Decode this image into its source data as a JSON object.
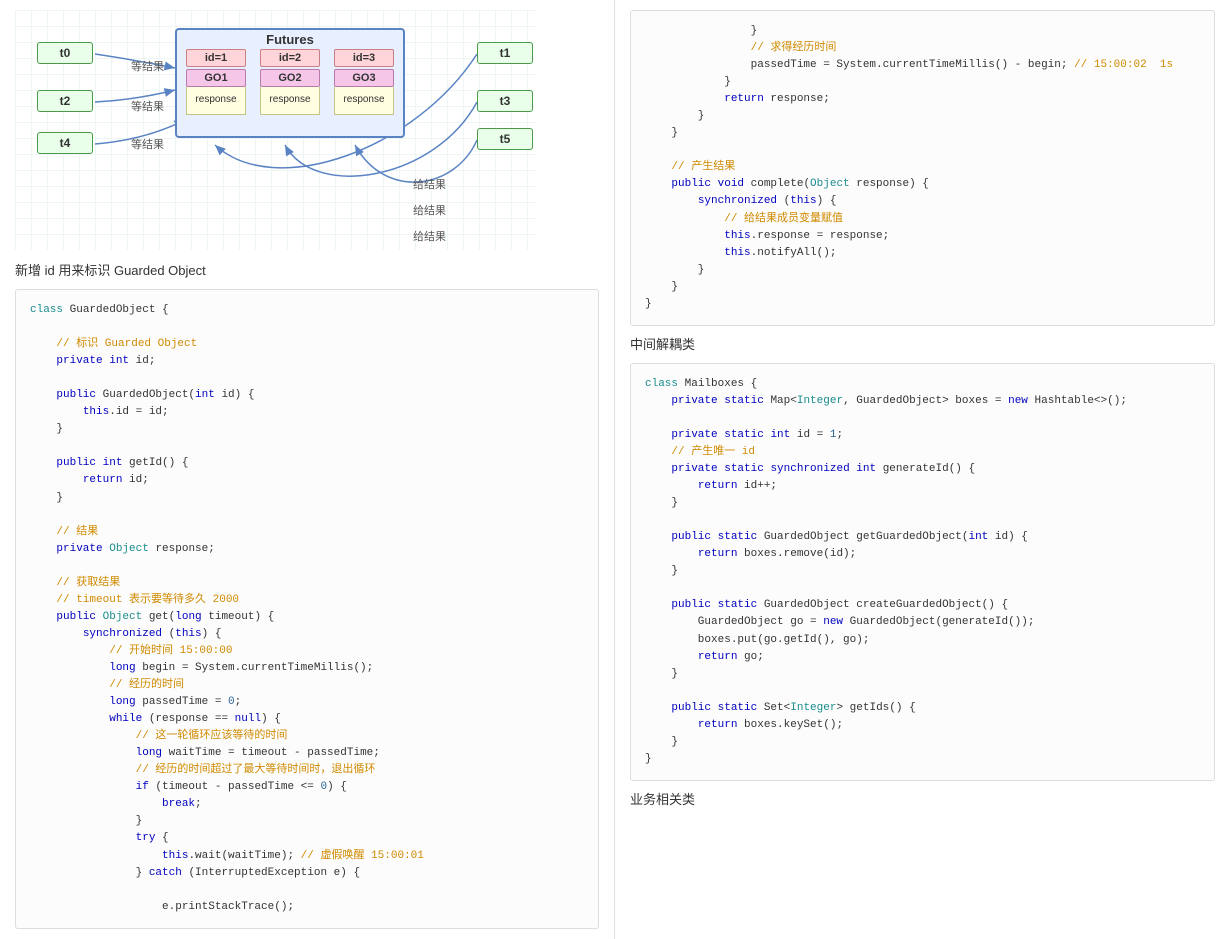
{
  "diagram": {
    "title": "Futures",
    "left_threads": [
      "t0",
      "t2",
      "t4"
    ],
    "right_threads": [
      "t1",
      "t3",
      "t5"
    ],
    "ids": [
      "id=1",
      "id=2",
      "id=3"
    ],
    "gos": [
      "GO1",
      "GO2",
      "GO3"
    ],
    "resps": [
      "response",
      "response",
      "response"
    ],
    "wait_label": "等结果",
    "give_label": "给结果"
  },
  "text": {
    "para1": "新增 id 用来标识 Guarded Object",
    "para2": "中间解耦类",
    "para3": "业务相关类"
  },
  "code1": {
    "t": [
      {
        "c": "cls",
        "v": "class"
      },
      {
        "v": " GuardedObject {"
      },
      {
        "v": "\n"
      },
      {
        "v": "\n"
      },
      {
        "v": "    "
      },
      {
        "c": "cmt",
        "v": "// 标识 Guarded Object"
      },
      {
        "v": "\n"
      },
      {
        "v": "    "
      },
      {
        "c": "kw",
        "v": "private"
      },
      {
        "v": " "
      },
      {
        "c": "kw",
        "v": "int"
      },
      {
        "v": " id;"
      },
      {
        "v": "\n"
      },
      {
        "v": "\n"
      },
      {
        "v": "    "
      },
      {
        "c": "kw",
        "v": "public"
      },
      {
        "v": " GuardedObject("
      },
      {
        "c": "kw",
        "v": "int"
      },
      {
        "v": " id) {"
      },
      {
        "v": "\n"
      },
      {
        "v": "        "
      },
      {
        "c": "kw",
        "v": "this"
      },
      {
        "v": ".id = id;"
      },
      {
        "v": "\n"
      },
      {
        "v": "    }"
      },
      {
        "v": "\n"
      },
      {
        "v": "\n"
      },
      {
        "v": "    "
      },
      {
        "c": "kw",
        "v": "public"
      },
      {
        "v": " "
      },
      {
        "c": "kw",
        "v": "int"
      },
      {
        "v": " getId() {"
      },
      {
        "v": "\n"
      },
      {
        "v": "        "
      },
      {
        "c": "kw",
        "v": "return"
      },
      {
        "v": " id;"
      },
      {
        "v": "\n"
      },
      {
        "v": "    }"
      },
      {
        "v": "\n"
      },
      {
        "v": "\n"
      },
      {
        "v": "    "
      },
      {
        "c": "cmt",
        "v": "// 结果"
      },
      {
        "v": "\n"
      },
      {
        "v": "    "
      },
      {
        "c": "kw",
        "v": "private"
      },
      {
        "v": " "
      },
      {
        "c": "cls",
        "v": "Object"
      },
      {
        "v": " response;"
      },
      {
        "v": "\n"
      },
      {
        "v": "\n"
      },
      {
        "v": "    "
      },
      {
        "c": "cmt",
        "v": "// 获取结果"
      },
      {
        "v": "\n"
      },
      {
        "v": "    "
      },
      {
        "c": "cmt",
        "v": "// timeout 表示要等待多久 2000"
      },
      {
        "v": "\n"
      },
      {
        "v": "    "
      },
      {
        "c": "kw",
        "v": "public"
      },
      {
        "v": " "
      },
      {
        "c": "cls",
        "v": "Object"
      },
      {
        "v": " get("
      },
      {
        "c": "kw",
        "v": "long"
      },
      {
        "v": " timeout) {"
      },
      {
        "v": "\n"
      },
      {
        "v": "        "
      },
      {
        "c": "kw",
        "v": "synchronized"
      },
      {
        "v": " ("
      },
      {
        "c": "kw",
        "v": "this"
      },
      {
        "v": ") {"
      },
      {
        "v": "\n"
      },
      {
        "v": "            "
      },
      {
        "c": "cmt",
        "v": "// 开始时间 15:00:00"
      },
      {
        "v": "\n"
      },
      {
        "v": "            "
      },
      {
        "c": "kw",
        "v": "long"
      },
      {
        "v": " begin = System.currentTimeMillis();"
      },
      {
        "v": "\n"
      },
      {
        "v": "            "
      },
      {
        "c": "cmt",
        "v": "// 经历的时间"
      },
      {
        "v": "\n"
      },
      {
        "v": "            "
      },
      {
        "c": "kw",
        "v": "long"
      },
      {
        "v": " passedTime = "
      },
      {
        "c": "num",
        "v": "0"
      },
      {
        "v": ";"
      },
      {
        "v": "\n"
      },
      {
        "v": "            "
      },
      {
        "c": "kw",
        "v": "while"
      },
      {
        "v": " (response == "
      },
      {
        "c": "kw",
        "v": "null"
      },
      {
        "v": ") {"
      },
      {
        "v": "\n"
      },
      {
        "v": "                "
      },
      {
        "c": "cmt",
        "v": "// 这一轮循环应该等待的时间"
      },
      {
        "v": "\n"
      },
      {
        "v": "                "
      },
      {
        "c": "kw",
        "v": "long"
      },
      {
        "v": " waitTime = timeout - passedTime;"
      },
      {
        "v": "\n"
      },
      {
        "v": "                "
      },
      {
        "c": "cmt",
        "v": "// 经历的时间超过了最大等待时间时，退出循环"
      },
      {
        "v": "\n"
      },
      {
        "v": "                "
      },
      {
        "c": "kw",
        "v": "if"
      },
      {
        "v": " (timeout - passedTime <= "
      },
      {
        "c": "num",
        "v": "0"
      },
      {
        "v": ") {"
      },
      {
        "v": "\n"
      },
      {
        "v": "                    "
      },
      {
        "c": "kw",
        "v": "break"
      },
      {
        "v": ";"
      },
      {
        "v": "\n"
      },
      {
        "v": "                }"
      },
      {
        "v": "\n"
      },
      {
        "v": "                "
      },
      {
        "c": "kw",
        "v": "try"
      },
      {
        "v": " {"
      },
      {
        "v": "\n"
      },
      {
        "v": "                    "
      },
      {
        "c": "kw",
        "v": "this"
      },
      {
        "v": ".wait(waitTime); "
      },
      {
        "c": "cmt",
        "v": "// 虚假唤醒 15:00:01"
      },
      {
        "v": "\n"
      },
      {
        "v": "                } "
      },
      {
        "c": "kw",
        "v": "catch"
      },
      {
        "v": " (InterruptedException e) {"
      },
      {
        "v": "\n"
      },
      {
        "v": "\n"
      },
      {
        "v": "                    e.printStackTrace();"
      }
    ]
  },
  "code2": {
    "t": [
      {
        "v": "                }"
      },
      {
        "v": "\n"
      },
      {
        "v": "                "
      },
      {
        "c": "cmt",
        "v": "// 求得经历时间"
      },
      {
        "v": "\n"
      },
      {
        "v": "                passedTime = System.currentTimeMillis() - begin; "
      },
      {
        "c": "cmt",
        "v": "// 15:00:02  1s"
      },
      {
        "v": "\n"
      },
      {
        "v": "            }"
      },
      {
        "v": "\n"
      },
      {
        "v": "            "
      },
      {
        "c": "kw",
        "v": "return"
      },
      {
        "v": " response;"
      },
      {
        "v": "\n"
      },
      {
        "v": "        }"
      },
      {
        "v": "\n"
      },
      {
        "v": "    }"
      },
      {
        "v": "\n"
      },
      {
        "v": "\n"
      },
      {
        "v": "    "
      },
      {
        "c": "cmt",
        "v": "// 产生结果"
      },
      {
        "v": "\n"
      },
      {
        "v": "    "
      },
      {
        "c": "kw",
        "v": "public"
      },
      {
        "v": " "
      },
      {
        "c": "kw",
        "v": "void"
      },
      {
        "v": " complete("
      },
      {
        "c": "cls",
        "v": "Object"
      },
      {
        "v": " response) {"
      },
      {
        "v": "\n"
      },
      {
        "v": "        "
      },
      {
        "c": "kw",
        "v": "synchronized"
      },
      {
        "v": " ("
      },
      {
        "c": "kw",
        "v": "this"
      },
      {
        "v": ") {"
      },
      {
        "v": "\n"
      },
      {
        "v": "            "
      },
      {
        "c": "cmt",
        "v": "// 给结果成员变量赋值"
      },
      {
        "v": "\n"
      },
      {
        "v": "            "
      },
      {
        "c": "kw",
        "v": "this"
      },
      {
        "v": ".response = response;"
      },
      {
        "v": "\n"
      },
      {
        "v": "            "
      },
      {
        "c": "kw",
        "v": "this"
      },
      {
        "v": ".notifyAll();"
      },
      {
        "v": "\n"
      },
      {
        "v": "        }"
      },
      {
        "v": "\n"
      },
      {
        "v": "    }"
      },
      {
        "v": "\n"
      },
      {
        "v": "}"
      }
    ]
  },
  "code3": {
    "t": [
      {
        "c": "cls",
        "v": "class"
      },
      {
        "v": " Mailboxes {"
      },
      {
        "v": "\n"
      },
      {
        "v": "    "
      },
      {
        "c": "kw",
        "v": "private"
      },
      {
        "v": " "
      },
      {
        "c": "kw",
        "v": "static"
      },
      {
        "v": " Map<"
      },
      {
        "c": "cls",
        "v": "Integer"
      },
      {
        "v": ", GuardedObject> boxes = "
      },
      {
        "c": "kw",
        "v": "new"
      },
      {
        "v": " Hashtable<>();"
      },
      {
        "v": "\n"
      },
      {
        "v": "\n"
      },
      {
        "v": "    "
      },
      {
        "c": "kw",
        "v": "private"
      },
      {
        "v": " "
      },
      {
        "c": "kw",
        "v": "static"
      },
      {
        "v": " "
      },
      {
        "c": "kw",
        "v": "int"
      },
      {
        "v": " id = "
      },
      {
        "c": "num",
        "v": "1"
      },
      {
        "v": ";"
      },
      {
        "v": "\n"
      },
      {
        "v": "    "
      },
      {
        "c": "cmt",
        "v": "// 产生唯一 id"
      },
      {
        "v": "\n"
      },
      {
        "v": "    "
      },
      {
        "c": "kw",
        "v": "private"
      },
      {
        "v": " "
      },
      {
        "c": "kw",
        "v": "static"
      },
      {
        "v": " "
      },
      {
        "c": "kw",
        "v": "synchronized"
      },
      {
        "v": " "
      },
      {
        "c": "kw",
        "v": "int"
      },
      {
        "v": " generateId() {"
      },
      {
        "v": "\n"
      },
      {
        "v": "        "
      },
      {
        "c": "kw",
        "v": "return"
      },
      {
        "v": " id++;"
      },
      {
        "v": "\n"
      },
      {
        "v": "    }"
      },
      {
        "v": "\n"
      },
      {
        "v": "\n"
      },
      {
        "v": "    "
      },
      {
        "c": "kw",
        "v": "public"
      },
      {
        "v": " "
      },
      {
        "c": "kw",
        "v": "static"
      },
      {
        "v": " GuardedObject getGuardedObject("
      },
      {
        "c": "kw",
        "v": "int"
      },
      {
        "v": " id) {"
      },
      {
        "v": "\n"
      },
      {
        "v": "        "
      },
      {
        "c": "kw",
        "v": "return"
      },
      {
        "v": " boxes.remove(id);"
      },
      {
        "v": "\n"
      },
      {
        "v": "    }"
      },
      {
        "v": "\n"
      },
      {
        "v": "\n"
      },
      {
        "v": "    "
      },
      {
        "c": "kw",
        "v": "public"
      },
      {
        "v": " "
      },
      {
        "c": "kw",
        "v": "static"
      },
      {
        "v": " GuardedObject createGuardedObject() {"
      },
      {
        "v": "\n"
      },
      {
        "v": "        GuardedObject go = "
      },
      {
        "c": "kw",
        "v": "new"
      },
      {
        "v": " GuardedObject(generateId());"
      },
      {
        "v": "\n"
      },
      {
        "v": "        boxes.put(go.getId(), go);"
      },
      {
        "v": "\n"
      },
      {
        "v": "        "
      },
      {
        "c": "kw",
        "v": "return"
      },
      {
        "v": " go;"
      },
      {
        "v": "\n"
      },
      {
        "v": "    }"
      },
      {
        "v": "\n"
      },
      {
        "v": "\n"
      },
      {
        "v": "    "
      },
      {
        "c": "kw",
        "v": "public"
      },
      {
        "v": " "
      },
      {
        "c": "kw",
        "v": "static"
      },
      {
        "v": " Set<"
      },
      {
        "c": "cls",
        "v": "Integer"
      },
      {
        "v": "> getIds() {"
      },
      {
        "v": "\n"
      },
      {
        "v": "        "
      },
      {
        "c": "kw",
        "v": "return"
      },
      {
        "v": " boxes.keySet();"
      },
      {
        "v": "\n"
      },
      {
        "v": "    }"
      },
      {
        "v": "\n"
      },
      {
        "v": "}"
      }
    ]
  }
}
